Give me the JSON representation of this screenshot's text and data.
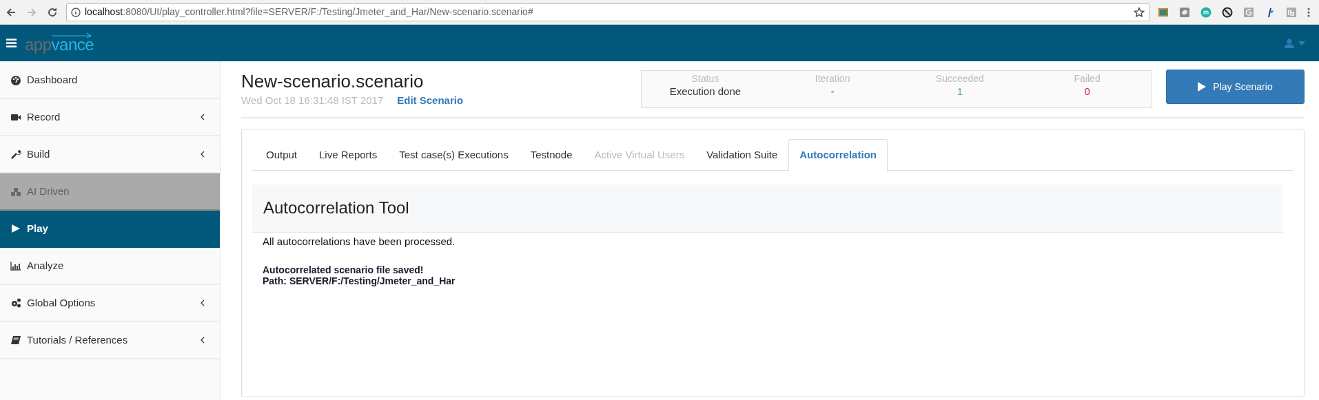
{
  "browser": {
    "url_host": "localhost",
    "url_rest": ":8080/UI/play_controller.html?file=SERVER/F:/Testing/Jmeter_and_Har/New-scenario.scenario#"
  },
  "logo": {
    "part1": "app",
    "part2": "vance"
  },
  "sidebar": {
    "items": [
      {
        "kind": "dashboard",
        "label": "Dashboard",
        "expandable": false,
        "disabled": false,
        "selected": false
      },
      {
        "kind": "record",
        "label": "Record",
        "expandable": true,
        "disabled": false,
        "selected": false
      },
      {
        "kind": "build",
        "label": "Build",
        "expandable": true,
        "disabled": false,
        "selected": false
      },
      {
        "kind": "ai",
        "label": "AI Driven",
        "expandable": false,
        "disabled": true,
        "selected": false
      },
      {
        "kind": "play",
        "label": "Play",
        "expandable": false,
        "disabled": false,
        "selected": true
      },
      {
        "kind": "analyze",
        "label": "Analyze",
        "expandable": false,
        "disabled": false,
        "selected": false
      },
      {
        "kind": "options",
        "label": "Global Options",
        "expandable": true,
        "disabled": false,
        "selected": false
      },
      {
        "kind": "tutorials",
        "label": "Tutorials / References",
        "expandable": true,
        "disabled": false,
        "selected": false
      }
    ]
  },
  "scenario": {
    "title": "New-scenario.scenario",
    "date": "Wed Oct 18 16:31:48 IST 2017",
    "edit_link": "Edit Scenario"
  },
  "stats": [
    {
      "label": "Status",
      "value": "Execution done",
      "color": "#333333"
    },
    {
      "label": "Iteration",
      "value": "-",
      "color": "#333333"
    },
    {
      "label": "Succeeded",
      "value": "1",
      "color": "#5cb85c"
    },
    {
      "label": "Failed",
      "value": "0",
      "color": "#e8173e"
    }
  ],
  "play_button": "Play Scenario",
  "tabs": [
    {
      "label": "Output",
      "selected": false,
      "disabled": false
    },
    {
      "label": "Live Reports",
      "selected": false,
      "disabled": false
    },
    {
      "label": "Test case(s) Executions",
      "selected": false,
      "disabled": false
    },
    {
      "label": "Testnode",
      "selected": false,
      "disabled": false
    },
    {
      "label": "Active Virtual Users",
      "selected": false,
      "disabled": true
    },
    {
      "label": "Validation Suite",
      "selected": false,
      "disabled": false
    },
    {
      "label": "Autocorrelation",
      "selected": true,
      "disabled": false
    }
  ],
  "panel": {
    "title": "Autocorrelation Tool",
    "message": "All autocorrelations have been processed.",
    "saved_lines": [
      "Autocorrelated scenario file saved!",
      "Path: SERVER/F:/Testing/Jmeter_and_Har"
    ]
  }
}
